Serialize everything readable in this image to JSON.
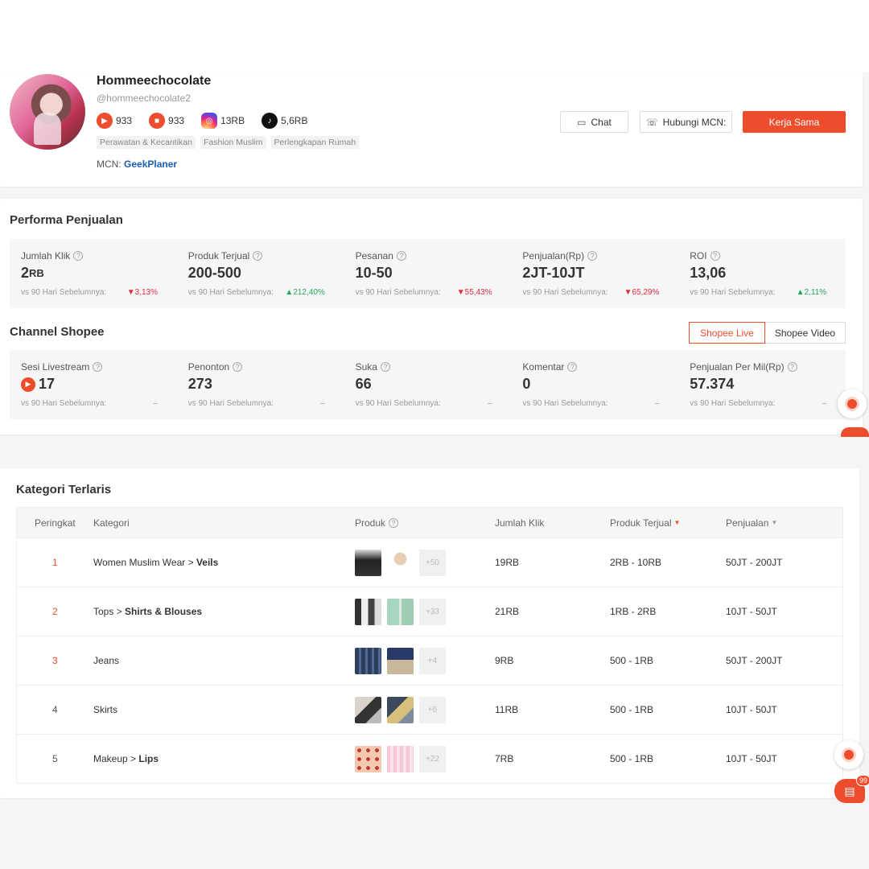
{
  "profile": {
    "name": "Hommeechocolate",
    "handle": "@hommeechocolate2",
    "stats": [
      {
        "icon": "shopee-live-icon",
        "value": "933"
      },
      {
        "icon": "shopee-video-icon",
        "value": "933"
      },
      {
        "icon": "instagram-icon",
        "value": "13RB"
      },
      {
        "icon": "tiktok-icon",
        "value": "5,6RB"
      }
    ],
    "tags": [
      "Perawatan & Kecantikan",
      "Fashion Muslim",
      "Perlengkapan Rumah"
    ],
    "mcn_label": "MCN:",
    "mcn_name": "GeekPlaner",
    "buttons": {
      "chat": "Chat",
      "contact_mcn": "Hubungi MCN:",
      "collab": "Kerja Sama"
    }
  },
  "performance": {
    "title": "Performa Penjualan",
    "compare_label": "vs 90 Hari Sebelumnya:",
    "metrics": [
      {
        "label": "Jumlah Klik",
        "value": "2",
        "unit": "RB",
        "change": "3,13%",
        "dir": "down"
      },
      {
        "label": "Produk Terjual",
        "value": "200-500",
        "unit": "",
        "change": "212,40%",
        "dir": "up"
      },
      {
        "label": "Pesanan",
        "value": "10-50",
        "unit": "",
        "change": "55,43%",
        "dir": "down"
      },
      {
        "label": "Penjualan(Rp)",
        "value": "2JT-10JT",
        "unit": "",
        "change": "65,29%",
        "dir": "down"
      },
      {
        "label": "ROI",
        "value": "13,06",
        "unit": "",
        "change": "2,11%",
        "dir": "up"
      }
    ]
  },
  "channel": {
    "title": "Channel Shopee",
    "tabs": [
      "Shopee Live",
      "Shopee Video"
    ],
    "active_tab": "Shopee Live",
    "metrics": [
      {
        "label": "Sesi Livestream",
        "value": "17",
        "change": "–"
      },
      {
        "label": "Penonton",
        "value": "273",
        "change": "–"
      },
      {
        "label": "Suka",
        "value": "66",
        "change": "–"
      },
      {
        "label": "Komentar",
        "value": "0",
        "change": "–"
      },
      {
        "label": "Penjualan Per Mil(Rp)",
        "value": "57.374",
        "change": "–"
      }
    ]
  },
  "categories": {
    "title": "Kategori Terlaris",
    "headers": [
      "Peringkat",
      "Kategori",
      "Produk",
      "Jumlah Klik",
      "Produk Terjual",
      "Penjualan"
    ],
    "rows": [
      {
        "rank": "1",
        "parent": "Women Muslim Wear",
        "child": "Veils",
        "more": "+50",
        "clicks": "19RB",
        "sold": "2RB - 10RB",
        "sales": "50JT - 200JT"
      },
      {
        "rank": "2",
        "parent": "Tops",
        "child": "Shirts & Blouses",
        "more": "+33",
        "clicks": "21RB",
        "sold": "1RB - 2RB",
        "sales": "10JT - 50JT"
      },
      {
        "rank": "3",
        "parent": "Jeans",
        "child": "",
        "more": "+4",
        "clicks": "9RB",
        "sold": "500 - 1RB",
        "sales": "50JT - 200JT"
      },
      {
        "rank": "4",
        "parent": "Skirts",
        "child": "",
        "more": "+6",
        "clicks": "11RB",
        "sold": "500 - 1RB",
        "sales": "10JT - 50JT"
      },
      {
        "rank": "5",
        "parent": "Makeup",
        "child": "Lips",
        "more": "+22",
        "clicks": "7RB",
        "sold": "500 - 1RB",
        "sales": "10JT - 50JT"
      }
    ]
  },
  "chat_badge": "99",
  "colors": {
    "accent": "#ee4d2d",
    "down": "#e02c3c",
    "up": "#1faa5a",
    "link": "#1a5fb4"
  }
}
